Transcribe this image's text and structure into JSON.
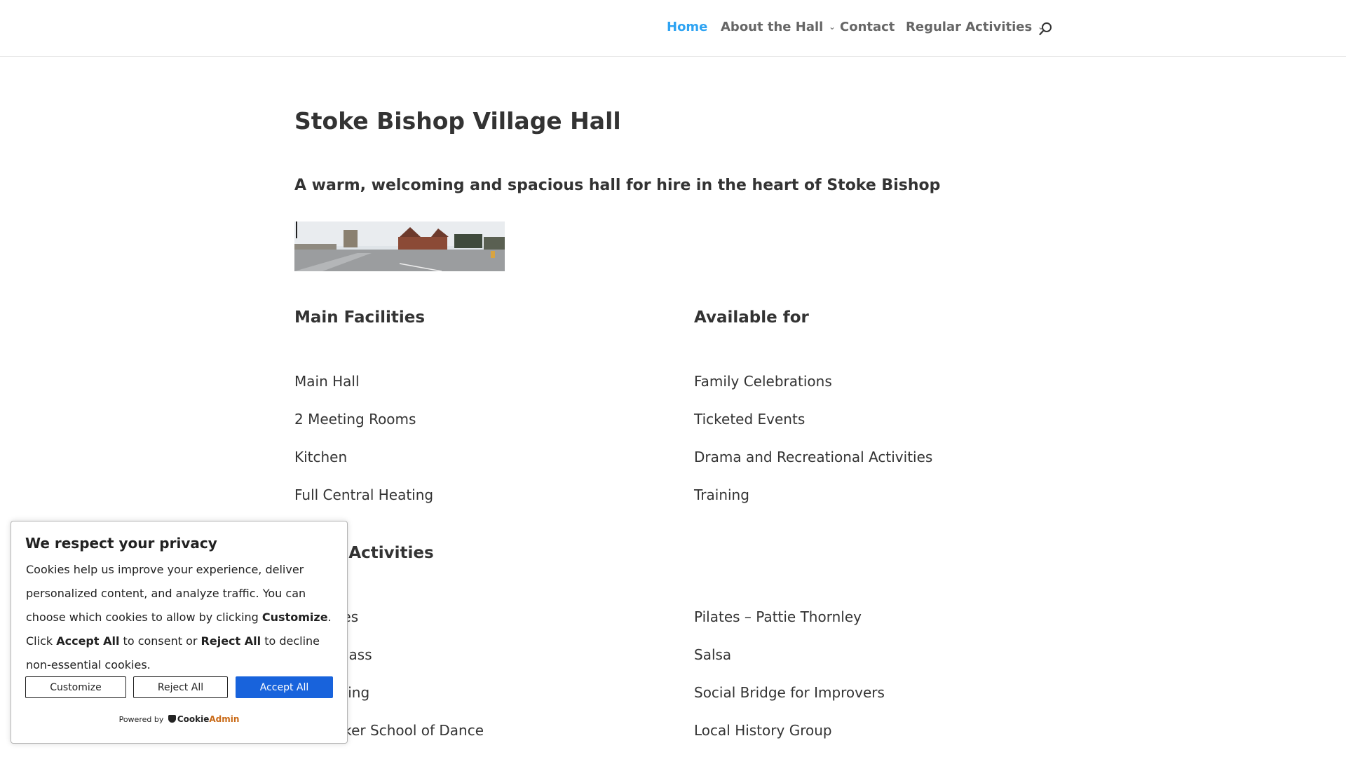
{
  "nav": {
    "home": "Home",
    "about": "About the Hall",
    "contact": "Contact",
    "activities": "Regular Activities",
    "chevron": "›"
  },
  "page": {
    "title": "Stoke Bishop Village Hall",
    "tagline": "A warm, welcoming and spacious hall for hire in the heart of Stoke Bishop"
  },
  "facilities": {
    "heading": "Main Facilities",
    "items": [
      "Main Hall",
      "2 Meeting Rooms",
      "Kitchen",
      "Full Central Heating"
    ]
  },
  "available": {
    "heading": "Available for",
    "items": [
      "Family Celebrations",
      "Ticketed Events",
      "Drama and Recreational Activities",
      "Training"
    ]
  },
  "activities": {
    "heading_visible": "r Activities",
    "left_visible": [
      "ses",
      "Class",
      "ining",
      "aker School of Dance"
    ],
    "right": [
      "Pilates – Pattie Thornley",
      "Salsa",
      "Social Bridge for Improvers",
      "Local History Group"
    ]
  },
  "cookie": {
    "title": "We respect your privacy",
    "text_1": "Cookies help us improve your experience, deliver personalized content, and analyze traffic. You can choose which cookies to allow by clicking ",
    "customize_word": "Customize",
    "text_2": ". Click ",
    "accept_all_word": "Accept All",
    "text_3": " to consent or ",
    "reject_all_word": "Reject All",
    "text_4": " to decline non-essential cookies.",
    "btn_customize": "Customize",
    "btn_reject": "Reject All",
    "btn_accept": "Accept All",
    "powered_by": "Powered by",
    "brand_a": "Cookie",
    "brand_b": "Admin"
  },
  "colors": {
    "accent": "#2ea3f2",
    "button_blue": "#1863dc"
  },
  "icons": [
    "search-icon",
    "chevron-down-icon",
    "cookieadmin-logo-icon"
  ]
}
